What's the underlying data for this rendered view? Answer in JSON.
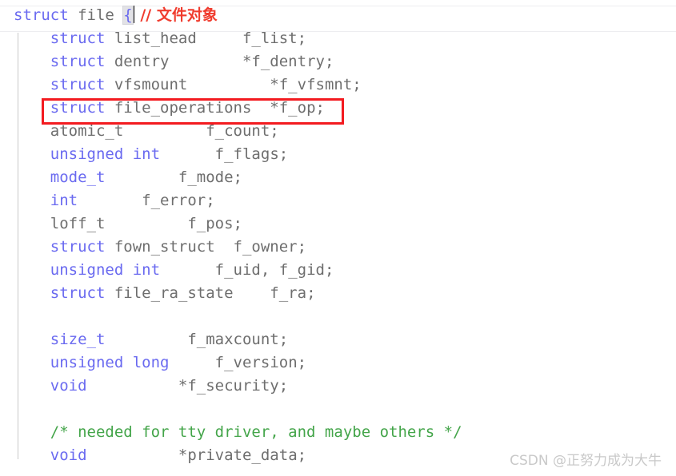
{
  "editor": {
    "language": "c",
    "colors": {
      "background": "#ffffff",
      "keyword": "#6a6af0",
      "identifier": "#6e6e6e",
      "comment_green": "#44a54a",
      "comment_red": "#f03c2e",
      "annotation_box": "#f31b20",
      "current_line_border": "#ededf0",
      "indent_guide": "#c8c8c8",
      "brace_match_bg": "#e2e2e6",
      "caret": "#000000",
      "watermark": "#c9c9c9"
    },
    "lines": [
      {
        "n": 1,
        "indent": "",
        "tokens": [
          {
            "t": "struct",
            "c": "kw"
          },
          {
            "t": " file ",
            "c": "plain"
          },
          {
            "t": "{",
            "c": "brace-match"
          },
          {
            "t": "CARET",
            "c": "caret"
          },
          {
            "t": " // 文件对象",
            "c": "cmt-red"
          }
        ]
      },
      {
        "n": 2,
        "indent": "    ",
        "tokens": [
          {
            "t": "struct",
            "c": "kw"
          },
          {
            "t": " list_head     f_list;",
            "c": "plain"
          }
        ]
      },
      {
        "n": 3,
        "indent": "    ",
        "tokens": [
          {
            "t": "struct",
            "c": "kw"
          },
          {
            "t": " dentry        *f_dentry;",
            "c": "plain"
          }
        ]
      },
      {
        "n": 4,
        "indent": "    ",
        "tokens": [
          {
            "t": "struct",
            "c": "kw"
          },
          {
            "t": " vfsmount         *f_vfsmnt;",
            "c": "plain"
          }
        ]
      },
      {
        "n": 5,
        "indent": "    ",
        "tokens": [
          {
            "t": "struct",
            "c": "kw"
          },
          {
            "t": " file_operations  *f_op;",
            "c": "plain"
          }
        ]
      },
      {
        "n": 6,
        "indent": "    ",
        "tokens": [
          {
            "t": "atomic_t         f_count;",
            "c": "plain"
          }
        ]
      },
      {
        "n": 7,
        "indent": "    ",
        "tokens": [
          {
            "t": "unsigned int",
            "c": "kw"
          },
          {
            "t": "      f_flags;",
            "c": "plain"
          }
        ]
      },
      {
        "n": 8,
        "indent": "    ",
        "tokens": [
          {
            "t": "mode_t",
            "c": "kw"
          },
          {
            "t": "        f_mode;",
            "c": "plain"
          }
        ]
      },
      {
        "n": 9,
        "indent": "    ",
        "tokens": [
          {
            "t": "int",
            "c": "kw"
          },
          {
            "t": "       f_error;",
            "c": "plain"
          }
        ]
      },
      {
        "n": 10,
        "indent": "    ",
        "tokens": [
          {
            "t": "loff_t         f_pos;",
            "c": "plain"
          }
        ]
      },
      {
        "n": 11,
        "indent": "    ",
        "tokens": [
          {
            "t": "struct",
            "c": "kw"
          },
          {
            "t": " fown_struct  f_owner;",
            "c": "plain"
          }
        ]
      },
      {
        "n": 12,
        "indent": "    ",
        "tokens": [
          {
            "t": "unsigned int",
            "c": "kw"
          },
          {
            "t": "      f_uid, f_gid;",
            "c": "plain"
          }
        ]
      },
      {
        "n": 13,
        "indent": "    ",
        "tokens": [
          {
            "t": "struct",
            "c": "kw"
          },
          {
            "t": " file_ra_state    f_ra;",
            "c": "plain"
          }
        ]
      },
      {
        "n": 14,
        "indent": "",
        "tokens": []
      },
      {
        "n": 15,
        "indent": "    ",
        "tokens": [
          {
            "t": "size_t",
            "c": "kw"
          },
          {
            "t": "         f_maxcount;",
            "c": "plain"
          }
        ]
      },
      {
        "n": 16,
        "indent": "    ",
        "tokens": [
          {
            "t": "unsigned long",
            "c": "kw"
          },
          {
            "t": "     f_version;",
            "c": "plain"
          }
        ]
      },
      {
        "n": 17,
        "indent": "    ",
        "tokens": [
          {
            "t": "void",
            "c": "kw"
          },
          {
            "t": "          *f_security;",
            "c": "plain"
          }
        ]
      },
      {
        "n": 18,
        "indent": "",
        "tokens": []
      },
      {
        "n": 19,
        "indent": "    ",
        "tokens": [
          {
            "t": "/* needed for tty driver, and maybe others */",
            "c": "cmt-grn"
          }
        ]
      },
      {
        "n": 20,
        "indent": "    ",
        "tokens": [
          {
            "t": "void",
            "c": "kw"
          },
          {
            "t": "          *private_data;",
            "c": "plain"
          }
        ]
      }
    ]
  },
  "annotation": {
    "box_target_line": 5,
    "box_target_text": "struct file_operations  *f_op;"
  },
  "watermark": {
    "text": "CSDN @正努力成为大牛"
  }
}
